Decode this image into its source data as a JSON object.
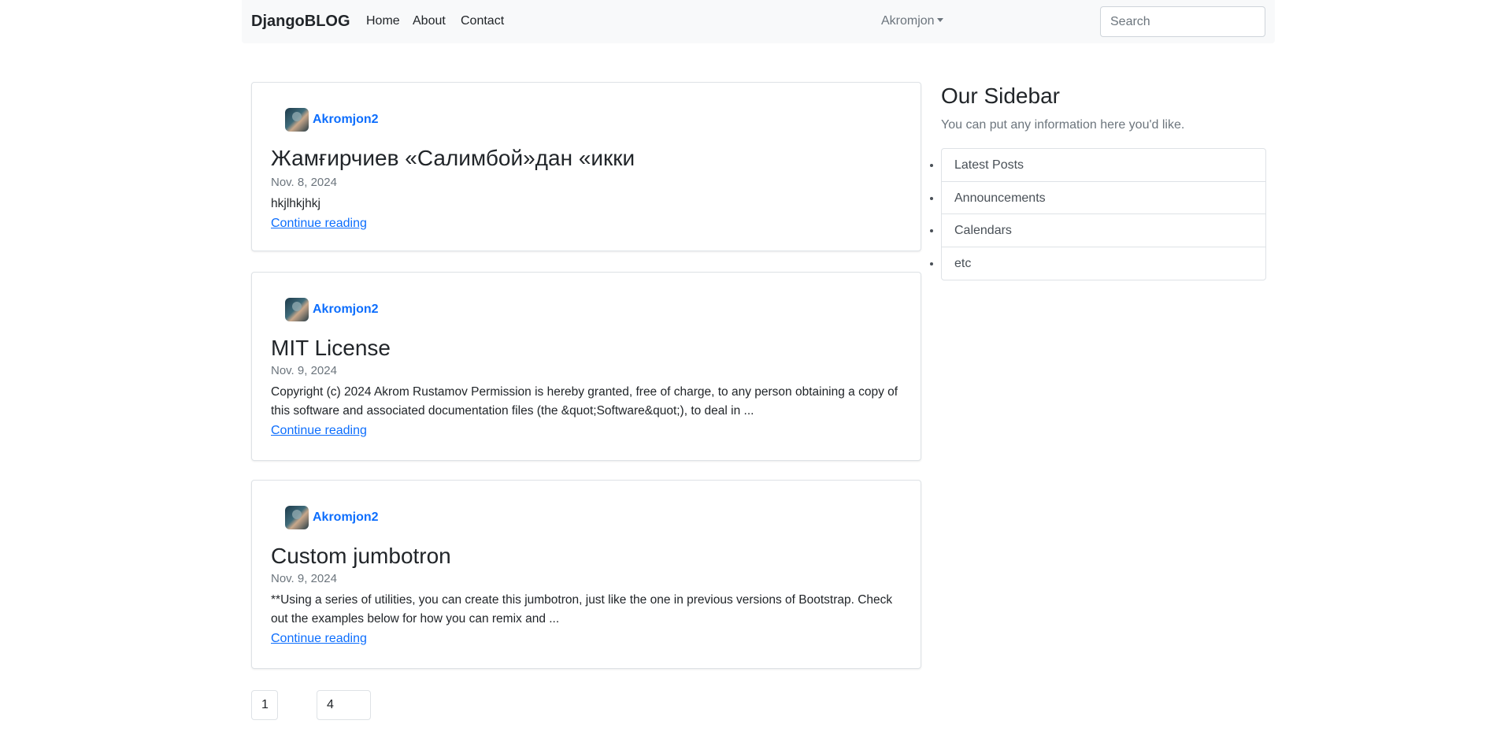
{
  "navbar": {
    "brand": "DjangoBLOG",
    "links": [
      "Home",
      "About",
      "Contact"
    ],
    "user": "Akromjon",
    "search_placeholder": "Search"
  },
  "posts": [
    {
      "author": "Akromjon2",
      "title": "Жамғирчиев «Салимбой»дан «икки",
      "date": "Nov. 8, 2024",
      "body": "hkjlhkjhkj",
      "link": "Continue reading"
    },
    {
      "author": "Akromjon2",
      "title": "MIT License",
      "date": "Nov. 9, 2024",
      "body": "Copyright (c) 2024 Akrom Rustamov Permission is hereby granted, free of charge, to any person obtaining a copy of this software and associated documentation files (the &quot;Software&quot;), to deal in ...",
      "link": "Continue reading"
    },
    {
      "author": "Akromjon2",
      "title": "Custom jumbotron",
      "date": "Nov. 9, 2024",
      "body": "**Using a series of utilities, you can create this jumbotron, just like the one in previous versions of Bootstrap. Check out the examples below for how you can remix and ...",
      "link": "Continue reading"
    }
  ],
  "pagination": {
    "first": "1",
    "last": "4"
  },
  "sidebar": {
    "title": "Our Sidebar",
    "text": "You can put any information here you'd like.",
    "items": [
      "Latest Posts",
      "Announcements",
      "Calendars",
      "etc"
    ]
  }
}
